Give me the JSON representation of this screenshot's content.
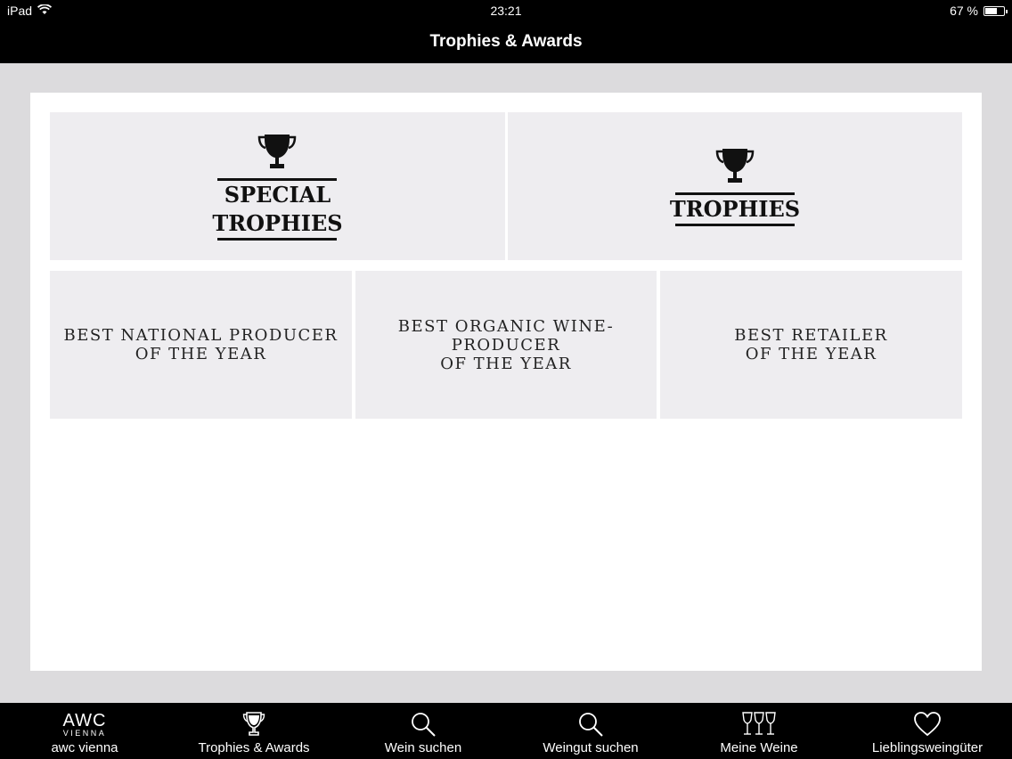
{
  "status_bar": {
    "device": "iPad",
    "time": "23:21",
    "battery_text": "67 %",
    "battery_level": 0.67
  },
  "nav": {
    "title": "Trophies & Awards"
  },
  "tiles": {
    "special_trophies": "SPECIAL\nTROPHIES",
    "trophies": "TROPHIES",
    "best_national_producer": "BEST NATIONAL PRODUCER\nOF THE YEAR",
    "best_organic_wine_producer": "BEST ORGANIC WINE-\nPRODUCER\nOF THE YEAR",
    "best_retailer": "BEST RETAILER\nOF THE YEAR"
  },
  "tab_bar": {
    "awc_logo_main": "AWC",
    "awc_logo_sub": "VIENNA",
    "tabs": [
      {
        "label": "awc vienna",
        "icon": "awc-logo-icon"
      },
      {
        "label": "Trophies & Awards",
        "icon": "trophy-icon"
      },
      {
        "label": "Wein suchen",
        "icon": "search-icon"
      },
      {
        "label": "Weingut suchen",
        "icon": "search-icon"
      },
      {
        "label": "Meine Weine",
        "icon": "wine-glasses-icon"
      },
      {
        "label": "Lieblingsweingüter",
        "icon": "heart-icon"
      }
    ]
  }
}
